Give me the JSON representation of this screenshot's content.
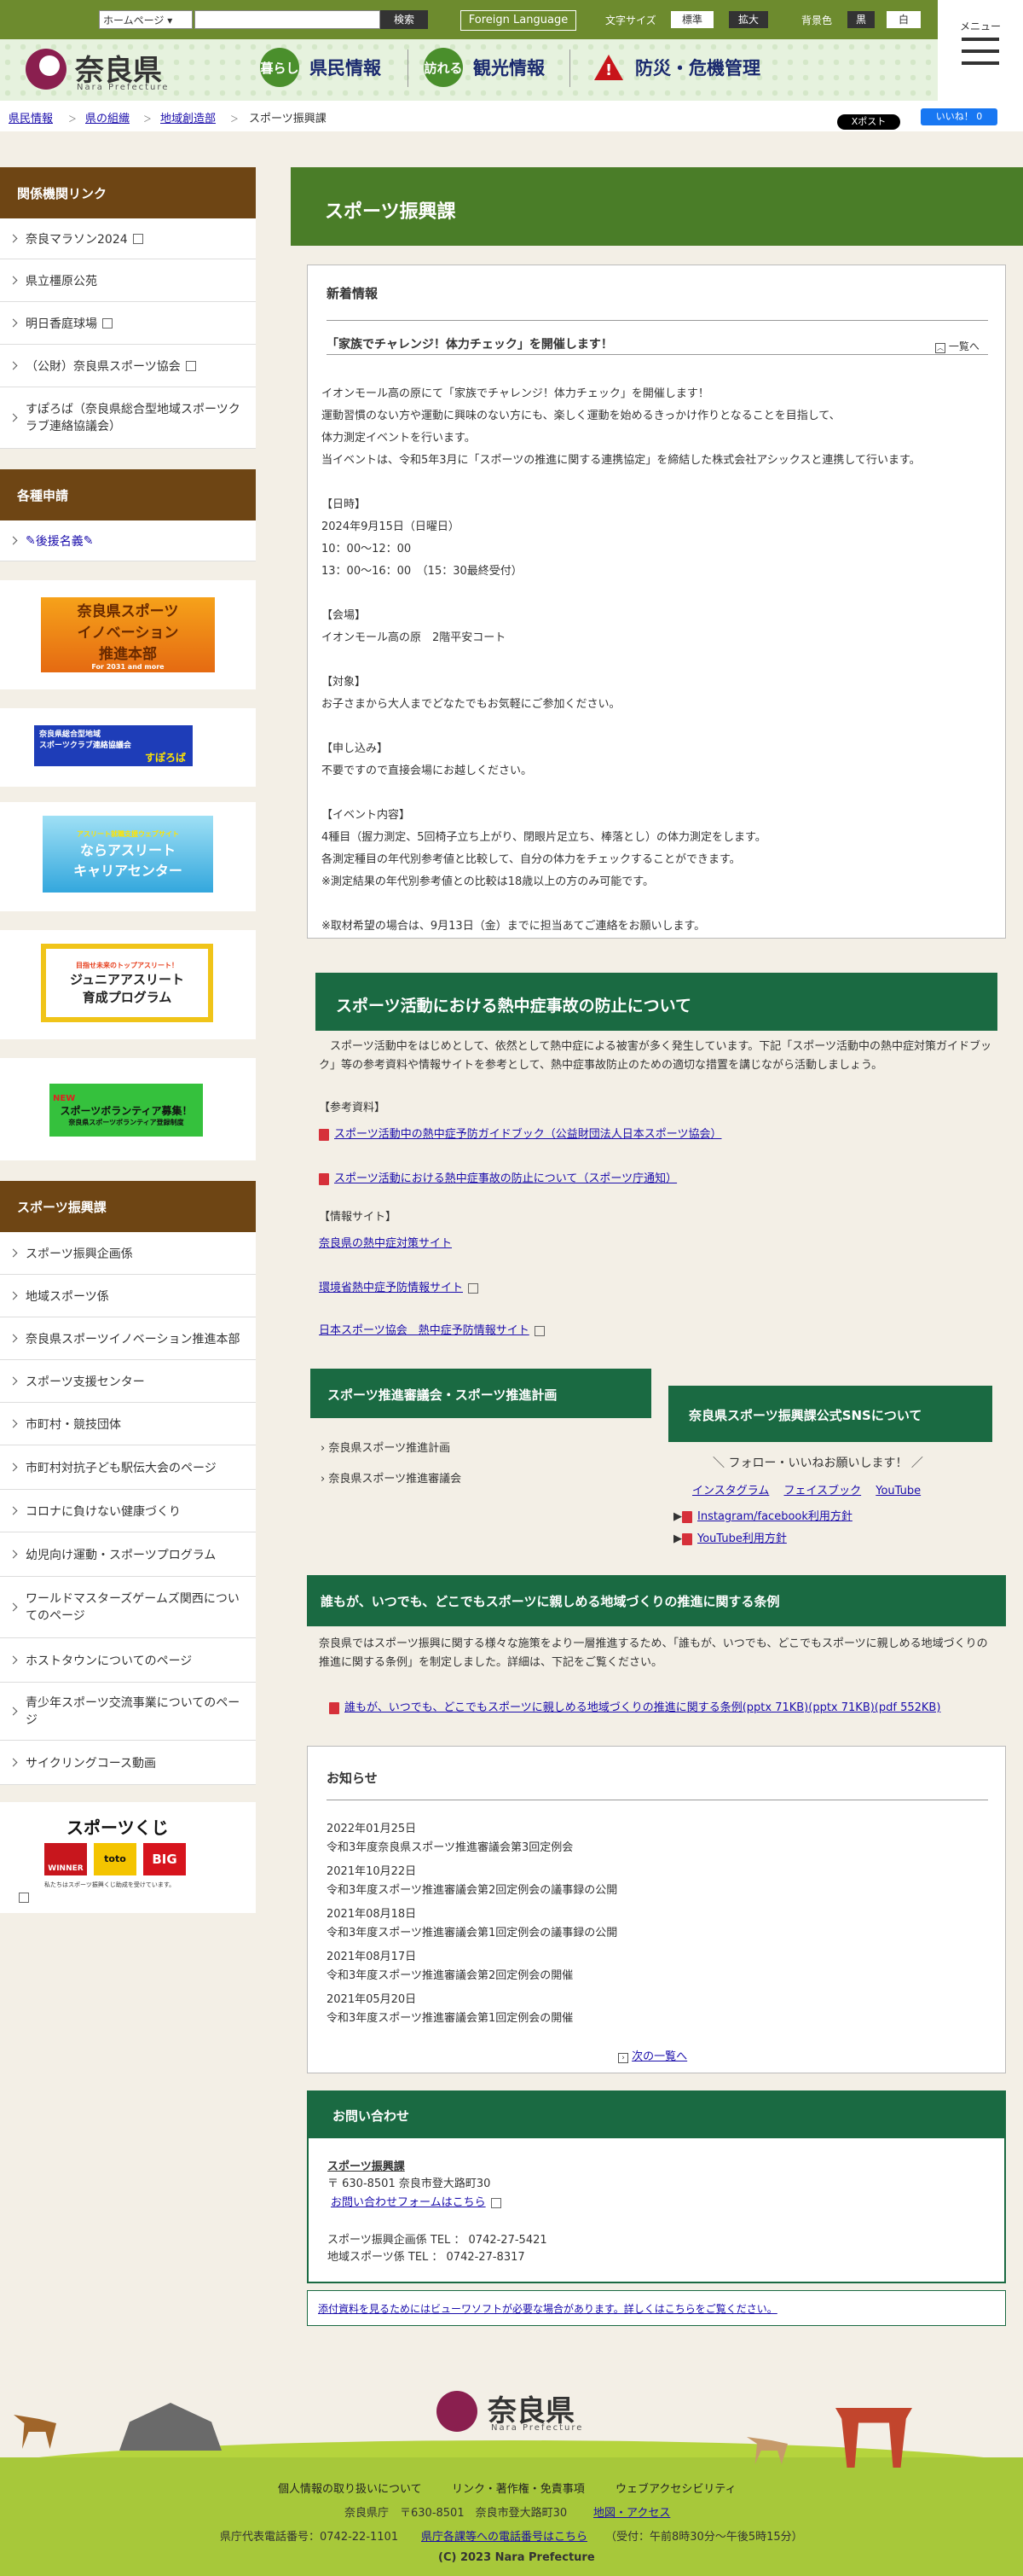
{
  "header": {
    "site_select": "ホームページ",
    "search_button": "検索",
    "foreign_language": "Foreign Language",
    "font_size_label": "文字サイズ",
    "font_standard": "標準",
    "font_large": "拡大",
    "bg_color_label": "背景色",
    "bg_black": "黒",
    "bg_white": "白",
    "menu_label": "メニュー",
    "logo_jp": "奈良県",
    "logo_en": "Nara Prefecture",
    "nav": [
      {
        "icon": "暮らし",
        "label": "県民情報"
      },
      {
        "icon": "訪れる",
        "label": "観光情報"
      },
      {
        "label": "防災・危機管理"
      }
    ]
  },
  "breadcrumb": [
    "県民情報",
    "県の組織",
    "地域創造部",
    "スポーツ振興課"
  ],
  "social": {
    "x_post": "Xポスト",
    "fb_like": "いいね！ 0"
  },
  "sidebar": {
    "related_title": "関係機関リンク",
    "related": [
      "奈良マラソン2024",
      "県立橿原公苑",
      "明日香庭球場",
      "（公財）奈良県スポーツ協会",
      "すぽろば（奈良県総合型地域スポーツクラブ連絡協議会）"
    ],
    "apply_title": "各種申請",
    "apply": [
      "後援名義"
    ],
    "banners": [
      {
        "line1": "奈良県スポーツ",
        "line2": "イノベーション",
        "line3": "推進本部",
        "small": "For 2031 and more"
      },
      {
        "line1": "奈良県総合型地域",
        "line2": "スポーツクラブ連絡協議会",
        "line3": "すぽろば"
      },
      {
        "line1": "アスリート就職支援ウェブサイト",
        "line2": "ならアスリート",
        "line3": "キャリアセンター"
      },
      {
        "line1": "目指せ未来のトップアスリート！",
        "line2": "ジュニアアスリート",
        "line3": "育成プログラム"
      },
      {
        "line1": "NEW",
        "line2": "スポーツボランティア募集！",
        "line3": "奈良県スポーツボランティア登録制度"
      }
    ],
    "sports_title": "スポーツ振興課",
    "sports": [
      "スポーツ振興企画係",
      "地域スポーツ係",
      "奈良県スポーツイノベーション推進本部",
      "スポーツ支援センター",
      "市町村・競技団体",
      "市町村対抗子ども駅伝大会のページ",
      "コロナに負けない健康づくり",
      "幼児向け運動・スポーツプログラム",
      "ワールドマスターズゲームズ関西についてのページ",
      "ホストタウンについてのページ",
      "青少年スポーツ交流事業についてのページ",
      "サイクリングコース動画"
    ],
    "toto_title": "スポーツくじ",
    "toto_items": [
      "WINNER",
      "toto",
      "BIG"
    ],
    "toto_small": "私たちはスポーツ振興くじ助成を受けています。"
  },
  "page_title": "スポーツ振興課",
  "news": {
    "heading": "新着情報",
    "headline": "「家族でチャレンジ！体力チェック」を開催します！",
    "list_link": "一覧へ",
    "paragraphs": [
      "イオンモール高の原にて「家族でチャレンジ！体力チェック」を開催します！",
      "運動習慣のない方や運動に興味のない方にも、楽しく運動を始めるきっかけ作りとなることを目指して、",
      "体力測定イベントを行います。",
      "当イベントは、令和5年3月に「スポーツの推進に関する連携協定」を締結した株式会社アシックスと連携して行います。",
      "",
      "【日時】",
      "2024年9月15日（日曜日）",
      "10：00～12：00",
      "13：00～16：00　（15：30最終受付）",
      "",
      "【会場】",
      "イオンモール高の原　2階平安コート",
      "",
      "【対象】",
      "お子さまから大人までどなたでもお気軽にご参加ください。",
      "",
      "【申し込み】",
      "不要ですので直接会場にお越しください。",
      "",
      "【イベント内容】",
      "4種目（握力測定、5回椅子立ち上がり、閉眼片足立ち、棒落とし）の体力測定をします。",
      "各測定種目の年代別参考値と比較して、自分の体力をチェックすることができます。",
      "※測定結果の年代別参考値との比較は18歳以上の方のみ可能です。",
      "",
      "※取材希望の場合は、9月13日（金）までに担当あてご連絡をお願いします。"
    ]
  },
  "heatstroke": {
    "heading": "スポーツ活動における熱中症事故の防止について",
    "intro": "　スポーツ活動中をはじめとして、依然として熱中症による被害が多く発生しています。下記「スポーツ活動中の熱中症対策ガイドブック」等の参考資料や情報サイトを参考として、熱中症事故防止のための適切な措置を講じながら活動しましょう。",
    "ref_label": "【参考資料】",
    "refs": [
      "スポーツ活動中の熱中症予防ガイドブック（公益財団法人日本スポーツ協会）",
      "スポーツ活動における熱中症事故の防止について（スポーツ庁通知）"
    ],
    "sites_label": "【情報サイト】",
    "sites": [
      "奈良県の熱中症対策サイト",
      "環境省熱中症予防情報サイト",
      "日本スポーツ協会　熱中症予防情報サイト"
    ]
  },
  "council": {
    "heading": "スポーツ推進審議会・スポーツ推進計画",
    "items": [
      "奈良県スポーツ推進計画",
      "奈良県スポーツ推進審議会"
    ]
  },
  "sns": {
    "heading": "奈良県スポーツ振興課公式SNSについて",
    "follow": "＼ フォロー・いいねお願いします！ ／",
    "icons": [
      "インスタグラム",
      "フェイスブック",
      "YouTube"
    ],
    "policies": [
      "Instagram/facebook利用方針",
      "YouTube利用方針"
    ]
  },
  "ordinance": {
    "heading": "誰もが、いつでも、どこでもスポーツに親しめる地域づくりの推進に関する条例",
    "body": "奈良県ではスポーツ振興に関する様々な施策をより一層推進するため、「誰もが、いつでも、どこでもスポーツに親しめる地域づくりの推進に関する条例」を制定しました。詳細は、下記をご覧ください。",
    "file": "誰もが、いつでも、どこでもスポーツに親しめる地域づくりの推進に関する条例(pptx 71KB)(pptx 71KB)(pdf 552KB)"
  },
  "notices": {
    "heading": "お知らせ",
    "items": [
      {
        "date": "2022年01月25日",
        "title": "令和3年度奈良県スポーツ推進審議会第3回定例会"
      },
      {
        "date": "2021年10月22日",
        "title": "令和3年度スポーツ推進審議会第2回定例会の議事録の公開"
      },
      {
        "date": "2021年08月18日",
        "title": "令和3年度スポーツ推進審議会第1回定例会の議事録の公開"
      },
      {
        "date": "2021年08月17日",
        "title": "令和3年度スポーツ推進審議会第2回定例会の開催"
      },
      {
        "date": "2021年05月20日",
        "title": "令和3年度スポーツ推進審議会第1回定例会の開催"
      }
    ],
    "next": "次の一覧へ"
  },
  "contact": {
    "heading": "お問い合わせ",
    "dept": "スポーツ振興課",
    "address": "〒 630-8501 奈良市登大路町30",
    "form": "お問い合わせフォームはこちら",
    "tel1": "スポーツ振興企画係 TEL ： 0742-27-5421",
    "tel2": "地域スポーツ係 TEL ： 0742-27-8317"
  },
  "viewer_note": "添付資料を見るためにはビューワソフトが必要な場合があります。詳しくはこちらをご覧ください。",
  "footer": {
    "logo_jp": "奈良県",
    "logo_en": "Nara Prefecture",
    "links": [
      "個人情報の取り扱いについて",
      "リンク・著作権・免責事項",
      "ウェブアクセシビリティ"
    ],
    "office": "奈良県庁　〒630-8501　奈良市登大路町30",
    "access": "地図・アクセス",
    "phone": "県庁代表電話番号：0742-22-1101",
    "phone_link": "県庁各課等への電話番号はこちら",
    "hours": "（受付：午前8時30分～午後5時15分）",
    "copyright": "(C) 2023 Nara Prefecture"
  },
  "colors": {
    "brown": "#6e4514",
    "green_band": "#4a7d28",
    "dark_green": "#1a6a42",
    "top_green": "#6d8b2e"
  }
}
